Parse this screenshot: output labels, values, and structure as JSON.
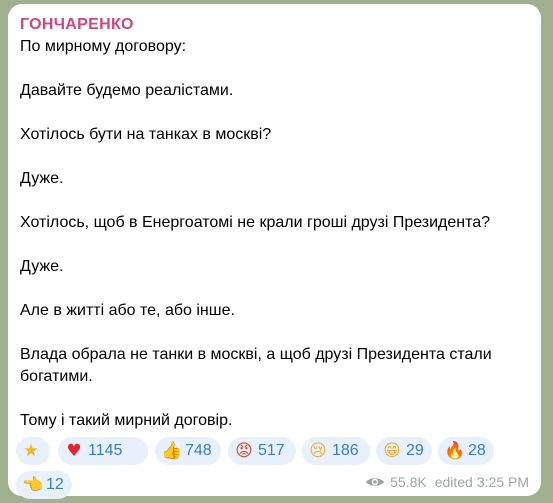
{
  "post": {
    "author": "ГОНЧАРЕНКО",
    "paragraphs": [
      "По мирному договору:",
      "Давайте будемо реалістами.",
      "Хотілось бути на танках в москві?",
      "Дуже.",
      "Хотілось, щоб в Енергоатомі не крали гроші друзі Президента?",
      "Дуже.",
      "Але в житті або те, або інше.",
      "Влада обрала не танки в москві, а щоб друзі Президента стали богатими.",
      "Тому і такий мирний договір."
    ]
  },
  "reactions": [
    {
      "icon": "star-icon",
      "glyph": "★",
      "count": ""
    },
    {
      "icon": "heart-icon",
      "glyph": "♥",
      "count": "1145"
    },
    {
      "icon": "thumbs-up-icon",
      "glyph": "👍",
      "count": "748"
    },
    {
      "icon": "angry-face-icon",
      "glyph": "😡",
      "count": "517"
    },
    {
      "icon": "crying-face-icon",
      "glyph": "😢",
      "count": "186"
    },
    {
      "icon": "grinning-face-icon",
      "glyph": "😁",
      "count": "29"
    },
    {
      "icon": "fire-icon",
      "glyph": "🔥",
      "count": "28"
    },
    {
      "icon": "pointing-hand-icon",
      "glyph": "👈",
      "count": "12"
    }
  ],
  "meta": {
    "views": "55.8K",
    "edited_label": "edited",
    "time": "3:25 PM"
  },
  "colors": {
    "author": "#d1477a",
    "reaction_bg": "#e7f0fb",
    "reaction_text": "#3a7fc1",
    "meta_text": "#9aa6a6"
  }
}
